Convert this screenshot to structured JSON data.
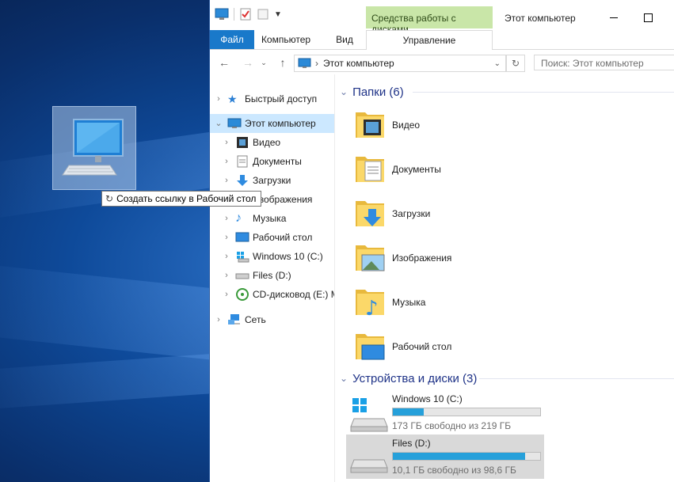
{
  "tooltip": {
    "text": "Создать ссылку в Рабочий стол"
  },
  "window": {
    "title": "Этот компьютер",
    "contextual_tab_header": "Средства работы с дисками",
    "ribbon_tabs": [
      "Файл",
      "Компьютер",
      "Вид",
      "Управление"
    ],
    "address": "Этот компьютер",
    "search_placeholder": "Поиск: Этот компьютер"
  },
  "nav_pane": {
    "quick_access": "Быстрый доступ",
    "this_pc": "Этот компьютер",
    "items": [
      "Видео",
      "Документы",
      "Загрузки",
      "Изображения",
      "Музыка",
      "Рабочий стол",
      "Windows 10 (C:)",
      "Files (D:)",
      "CD-дисковод (E:) M"
    ],
    "network": "Сеть"
  },
  "content": {
    "folders_header": "Папки (6)",
    "folders": [
      "Видео",
      "Документы",
      "Загрузки",
      "Изображения",
      "Музыка",
      "Рабочий стол"
    ],
    "devices_header": "Устройства и диски (3)",
    "drives": [
      {
        "name": "Windows 10 (C:)",
        "free": "173 ГБ свободно из 219 ГБ",
        "used_fraction": 0.21
      },
      {
        "name": "Files (D:)",
        "free": "10,1 ГБ свободно из 98,6 ГБ",
        "used_fraction": 0.9
      }
    ]
  },
  "colors": {
    "accent": "#1979ca",
    "selection": "#cce8ff",
    "drive_bar": "#26a0da",
    "context_tab": "#c9e6a8"
  }
}
